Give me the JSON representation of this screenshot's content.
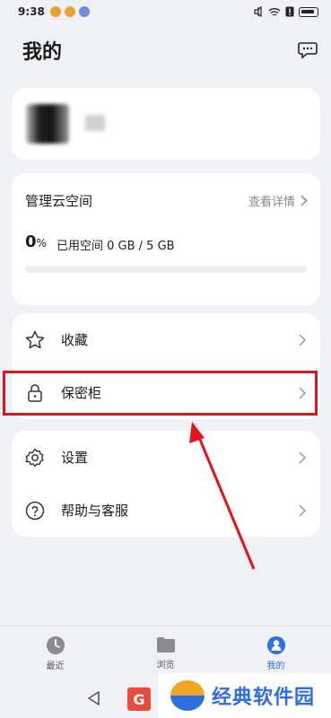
{
  "status_bar": {
    "time": "9:38"
  },
  "header": {
    "title": "我的"
  },
  "cloud": {
    "title": "管理云空间",
    "detail_label": "查看详情",
    "percent": "0",
    "percent_unit": "%",
    "usage_text": "已用空间 0 GB / 5 GB",
    "progress_fraction": 0.0
  },
  "menu_group1": [
    {
      "label": "收藏",
      "icon": "star-icon"
    },
    {
      "label": "保密柜",
      "icon": "lock-icon"
    }
  ],
  "menu_group2": [
    {
      "label": "设置",
      "icon": "gear-icon"
    },
    {
      "label": "帮助与客服",
      "icon": "help-icon"
    }
  ],
  "tabs": [
    {
      "label": "最近",
      "icon": "clock-icon",
      "active": false
    },
    {
      "label": "浏览",
      "icon": "folder-icon",
      "active": false
    },
    {
      "label": "我的",
      "icon": "person-icon",
      "active": true
    }
  ],
  "watermark": {
    "text": "经典软件园",
    "box_letter": "G"
  },
  "colors": {
    "accent": "#2a6ee8",
    "highlight": "#e3131b",
    "arrow": "#e3131b"
  }
}
